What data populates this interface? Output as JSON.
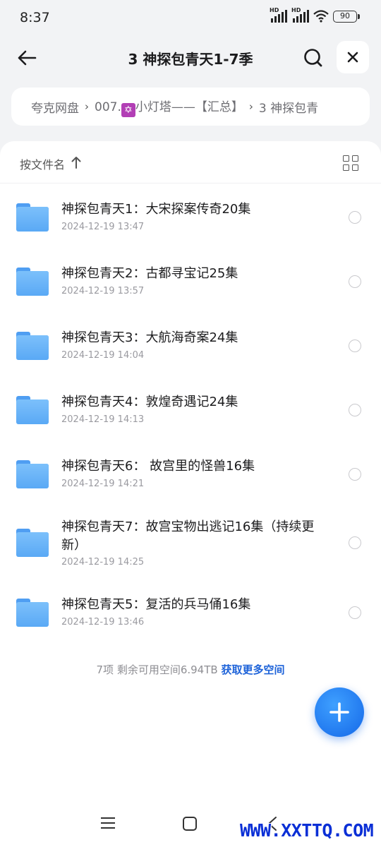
{
  "status_bar": {
    "time": "8:37",
    "battery": "90",
    "network": "HD"
  },
  "header": {
    "title": "3 神探包青天1-7季"
  },
  "breadcrumb": {
    "items": [
      "夸克网盘",
      "007.",
      "小灯塔——【汇总】",
      "3 神探包青"
    ],
    "badge": "✡"
  },
  "sort": {
    "label": "按文件名"
  },
  "files": [
    {
      "name": "神探包青天1：大宋探案传奇20集",
      "date": "2024-12-19 13:47"
    },
    {
      "name": "神探包青天2：古都寻宝记25集",
      "date": "2024-12-19 13:57"
    },
    {
      "name": "神探包青天3：大航海奇案24集",
      "date": "2024-12-19 14:04"
    },
    {
      "name": "神探包青天4：敦煌奇遇记24集",
      "date": "2024-12-19 14:13"
    },
    {
      "name": "神探包青天6： 故宫里的怪兽16集",
      "date": "2024-12-19 14:21"
    },
    {
      "name": "神探包青天7：故宫宝物出逃记16集（持续更新）",
      "date": "2024-12-19 14:25"
    },
    {
      "name": "神探包青天5：复活的兵马俑16集",
      "date": "2024-12-19 13:46"
    }
  ],
  "footer": {
    "count": "7项",
    "space": "剩余可用空间6.94TB",
    "more": "获取更多空间"
  },
  "watermark": "WWW.XXTTQ.COM",
  "colors": {
    "accent": "#1e63d9",
    "folder": "#5aa9f5",
    "fab": "#1468e8"
  }
}
